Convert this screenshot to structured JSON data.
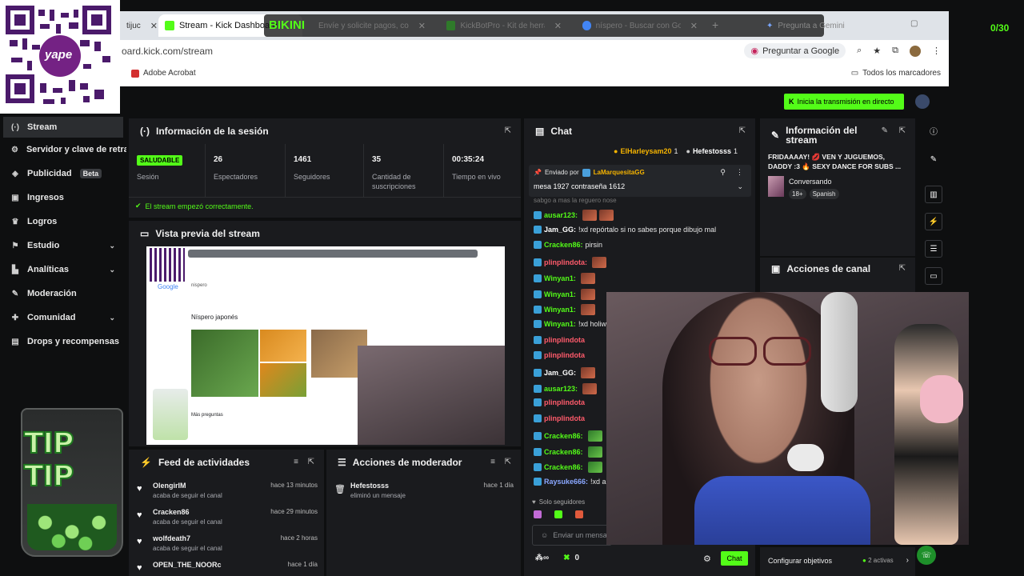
{
  "browser": {
    "tabs": [
      {
        "label": "tijuc",
        "color": "#ffffff"
      },
      {
        "label": "Stream - Kick Dashboard",
        "color": "#53fc18"
      },
      {
        "label": "Envíe y solicite pagos, com",
        "color": "#1a73e8"
      },
      {
        "label": "KickBotPro - Kit de herram",
        "color": "#2f7a2a"
      },
      {
        "label": "níspero - Buscar con Google",
        "color": "#4285f4"
      }
    ],
    "gemini_label": "Pregunta a Gemini",
    "url": "oard.kick.com/stream",
    "ask_google": "Preguntar a Google",
    "bookmark_acrobat": "Adobe Acrobat",
    "all_bookmarks": "Todos los marcadores"
  },
  "overlay": {
    "bikini_text": "BIKINI",
    "counter": "0/30",
    "qr_logo_text": "yape",
    "tip_text": "TIP TIP"
  },
  "topbar": {
    "go_live": "Inicia la transmisión en directo"
  },
  "sidebar": {
    "items": [
      {
        "label": "Stream",
        "icon": "broadcast-icon",
        "glyph": "(·)"
      },
      {
        "label": "Servidor y clave de retransmisión",
        "icon": "key-icon",
        "glyph": "⚙"
      },
      {
        "label": "Publicidad",
        "icon": "megaphone-icon",
        "glyph": "◈",
        "badge": "Beta"
      },
      {
        "label": "Ingresos",
        "icon": "wallet-icon",
        "glyph": "▣"
      },
      {
        "label": "Logros",
        "icon": "trophy-icon",
        "glyph": "♛"
      },
      {
        "label": "Estudio",
        "icon": "studio-icon",
        "glyph": "⚑",
        "chevron": "⌄"
      },
      {
        "label": "Analíticas",
        "icon": "chart-icon",
        "glyph": "▙",
        "chevron": "⌄"
      },
      {
        "label": "Moderación",
        "icon": "wrench-icon",
        "glyph": "✎"
      },
      {
        "label": "Comunidad",
        "icon": "community-icon",
        "glyph": "✚",
        "chevron": "⌄"
      },
      {
        "label": "Drops y recompensas",
        "icon": "gift-icon",
        "glyph": "▤"
      }
    ]
  },
  "session": {
    "title": "Información de la sesión",
    "status_badge": "SALUDABLE",
    "status_label": "Sesión",
    "stats": [
      {
        "value": "26",
        "label": "Espectadores"
      },
      {
        "value": "1461",
        "label": "Seguidores"
      },
      {
        "value": "35",
        "label": "Cantidad de suscripciones"
      },
      {
        "value": "00:35:24",
        "label": "Tiempo en vivo"
      }
    ],
    "ok_message": "El stream empezó correctamente."
  },
  "preview": {
    "title": "Vista previa del stream",
    "search_result_title": "Níspero japonés",
    "search_query": "nispero",
    "more_questions": "Más preguntas"
  },
  "activity": {
    "title": "Feed de actividades",
    "items": [
      {
        "name": "OlengirIM",
        "text": "acaba de seguir el canal",
        "time": "hace 13 minutos"
      },
      {
        "name": "Cracken86",
        "text": "acaba de seguir el canal",
        "time": "hace 29 minutos"
      },
      {
        "name": "wolfdeath7",
        "text": "acaba de seguir el canal",
        "time": "hace 2 horas"
      },
      {
        "name": "OPEN_THE_NOORc",
        "text": "",
        "time": "hace 1 día"
      }
    ]
  },
  "mod_actions": {
    "title": "Acciones de moderador",
    "items": [
      {
        "name": "Hefestosss",
        "text": "eliminó un mensaje",
        "time": "hace 1 día"
      }
    ]
  },
  "chat": {
    "title": "Chat",
    "top_gifters": [
      {
        "name": "ElHarleysam20",
        "count": "1"
      },
      {
        "name": "Hefestosss",
        "count": "1"
      }
    ],
    "pinned": {
      "prefix": "Enviado por",
      "author": "LaMarquesitaGG",
      "message": "mesa 1927 contraseña 1612"
    },
    "cut_line": "sabgo a mas la reguero nose",
    "messages": [
      {
        "user": "ausar123:",
        "color": "green",
        "text": "",
        "emotes": 2
      },
      {
        "user": "Jam_GG:",
        "color": "white",
        "text": "!xd repórtalo si no sabes porque dibujo mal",
        "emotes": 0
      },
      {
        "user": "Cracken86:",
        "color": "green",
        "text": "pirsin",
        "emotes": 0
      },
      {
        "user": "plinplindota:",
        "color": "red",
        "text": "",
        "emotes": 1
      },
      {
        "user": "Winyan1:",
        "color": "green",
        "text": "",
        "emotes": 1
      },
      {
        "user": "Winyan1:",
        "color": "green",
        "text": "",
        "emotes": 1
      },
      {
        "user": "Winyan1:",
        "color": "green",
        "text": "",
        "emotes": 1
      },
      {
        "user": "Winyan1:",
        "color": "green",
        "text": "!xd holiw",
        "emotes": 0
      },
      {
        "user": "plinplindota",
        "color": "red",
        "text": "",
        "emotes": 0
      },
      {
        "user": "plinplindota",
        "color": "red",
        "text": "",
        "emotes": 0
      },
      {
        "user": "Jam_GG:",
        "color": "white",
        "text": "",
        "emotes": 1
      },
      {
        "user": "ausar123:",
        "color": "green",
        "text": "",
        "emotes": 1
      },
      {
        "user": "plinplindota",
        "color": "red",
        "text": "",
        "emotes": 0
      },
      {
        "user": "plinplindota",
        "color": "red",
        "text": "",
        "emotes": 0
      },
      {
        "user": "Cracken86:",
        "color": "green",
        "text": "",
        "emotes": 1
      },
      {
        "user": "Cracken86:",
        "color": "green",
        "text": "",
        "emotes": 1
      },
      {
        "user": "Cracken86:",
        "color": "green",
        "text": "",
        "emotes": 1
      },
      {
        "user": "Raysuke666:",
        "color": "blue",
        "text": "!xd abur",
        "emotes": 0
      }
    ],
    "followers_only": "Solo seguidores",
    "input_placeholder": "Enviar un mensaje",
    "points": "0",
    "send_label": "Chat"
  },
  "stream_info": {
    "title": "Información del stream",
    "stream_title": "FRIDAAAAY! 💋 VEN Y JUGUEMOS, DADDY :3 🔥 SEXY DANCE FOR SUBS ...",
    "category": "Conversando",
    "tags": [
      "18+",
      "Spanish"
    ]
  },
  "channel_actions": {
    "title": "Acciones de canal",
    "configure_goals": "Configurar objetivos",
    "active_goals": "2 activas"
  },
  "colors": {
    "kick_green": "#53fc18",
    "panel_bg": "#1a1b1e",
    "page_bg": "#0e0f10"
  }
}
